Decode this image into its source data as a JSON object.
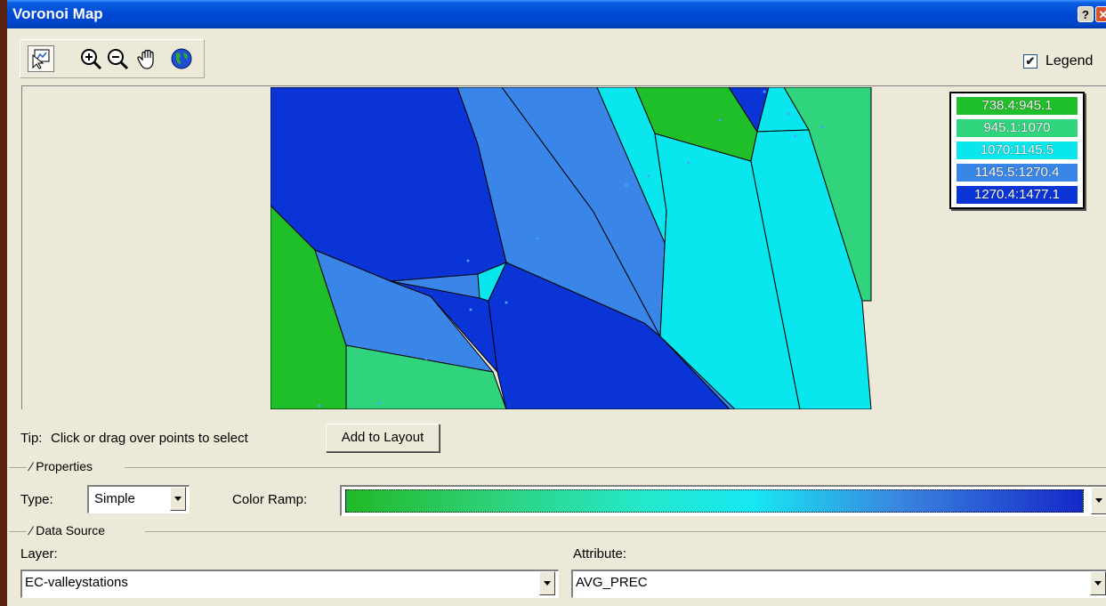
{
  "window": {
    "title": "Voronoi Map",
    "help_glyph": "?",
    "close_glyph": "✕"
  },
  "toolbar": {
    "tools": [
      "select-tool-icon",
      "zoom-in-icon",
      "zoom-out-icon",
      "pan-hand-icon",
      "full-extent-globe-icon"
    ],
    "legend_checked": true,
    "legend_label": "Legend",
    "check_glyph": "✔"
  },
  "legend": {
    "items": [
      {
        "label": "738.4:945.1",
        "color": "#1fbf2a"
      },
      {
        "label": "945.1:1070",
        "color": "#2fd47c"
      },
      {
        "label": "1070:1145.5",
        "color": "#0ae6ee"
      },
      {
        "label": "1145.5:1270.4",
        "color": "#3a86e8"
      },
      {
        "label": "1270.4:1477.1",
        "color": "#0b34d6"
      }
    ]
  },
  "tip": {
    "label": "Tip:",
    "text": "Click or drag over points to select"
  },
  "add_to_layout": "Add to Layout",
  "properties": {
    "group_title": "Properties",
    "type_label": "Type:",
    "type_value": "Simple",
    "color_ramp_label": "Color Ramp:"
  },
  "data_source": {
    "group_title": "Data Source",
    "layer_label": "Layer:",
    "layer_value": "EC-valleystations",
    "attribute_label": "Attribute:",
    "attribute_value": "AVG_PREC"
  }
}
